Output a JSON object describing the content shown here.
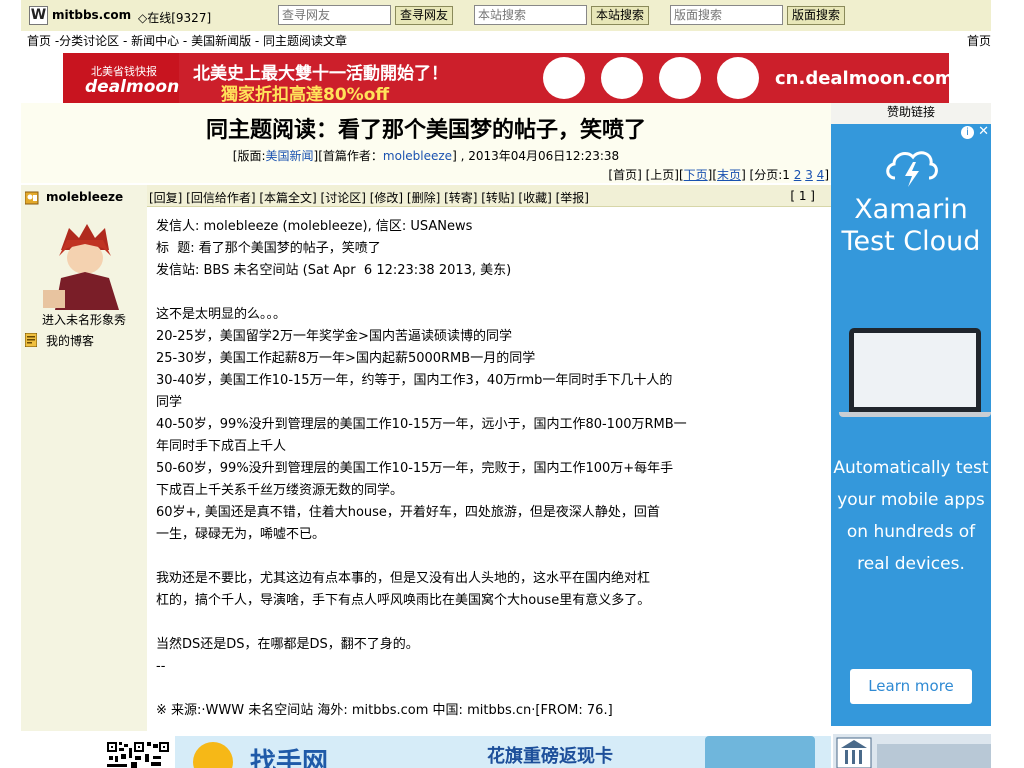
{
  "topbar": {
    "logo_letter": "W",
    "site_name": "mitbbs.com",
    "online_status": "◇在线[9327]",
    "search_friend_placeholder": "查寻网友",
    "search_friend_button": "查寻网友",
    "site_search_placeholder": "本站搜索",
    "site_search_button": "本站搜索",
    "board_search_placeholder": "版面搜索",
    "board_search_button": "版面搜索"
  },
  "breadcrumb": {
    "text": "首页 -分类讨论区 - 新闻中心 - 美国新闻版 - 同主题阅读文章",
    "home_right": "首页"
  },
  "dealmoon_banner": {
    "logo_small": "北美省钱快报",
    "logo_main": "dealmoon",
    "headline1": "北美史上最大雙十一活動開始了！",
    "headline2": "獨家折扣高達80%off",
    "url": "cn.dealmoon.com"
  },
  "thread": {
    "title": "同主题阅读：看了那个美国梦的帖子，笑喷了",
    "meta_prefix": "[版面:",
    "meta_board": "美国新闻",
    "meta_middle": "][首篇作者：",
    "meta_author": "molebleeze",
    "meta_suffix": "] , 2013年04月06日12:23:38",
    "pager_prefix": "[首页] [上页][",
    "pager_next": "下页",
    "pager_mid": "][",
    "pager_last": "末页",
    "pager_pages_label": "] [分页:1 ",
    "pager_page2": "2",
    "pager_page3": "3",
    "pager_page4": "4",
    "pager_close": "]"
  },
  "sponsor": {
    "label": "赞助链接",
    "info_icon": "i",
    "close_icon": "✕",
    "title_line1": "Xamarin",
    "title_line2": "Test Cloud",
    "body_line1": "Automatically test",
    "body_line2": "your mobile apps",
    "body_line3": "on hundreds of",
    "body_line4": "real devices.",
    "cta": "Learn more"
  },
  "author": {
    "name": "molebleeze",
    "avatar_caption": "进入未名形象秀",
    "blog_link": "我的博客"
  },
  "post": {
    "toolbar": "[回复] [回信给作者] [本篇全文] [讨论区] [修改] [删除] [转寄] [转贴] [收藏] [举报]",
    "floor": "[ 1 ]",
    "lines": [
      "发信人: molebleeze (molebleeze), 信区: USANews",
      "标  题: 看了那个美国梦的帖子，笑喷了",
      "发信站: BBS 未名空间站 (Sat Apr  6 12:23:38 2013, 美东)",
      "",
      "这不是太明显的么。。。",
      "20-25岁，美国留学2万一年奖学金>国内苦逼读硕读博的同学",
      "25-30岁，美国工作起薪8万一年>国内起薪5000RMB一月的同学",
      "30-40岁，美国工作10-15万一年，约等于，国内工作3，40万rmb一年同时手下几十人的",
      "同学",
      "40-50岁，99%没升到管理层的美国工作10-15万一年，远小于，国内工作80-100万RMB一",
      "年同时手下成百上千人",
      "50-60岁，99%没升到管理层的美国工作10-15万一年，完败于，国内工作100万+每年手",
      "下成百上千关系千丝万缕资源无数的同学。",
      "60岁+, 美国还是真不错，住着大house，开着好车，四处旅游，但是夜深人静处，回首",
      "一生，碌碌无为，唏嘘不已。",
      "",
      "我劝还是不要比，尤其这边有点本事的，但是又没有出人头地的，这水平在国内绝对杠",
      "杠的，搞个千人，导演啥，手下有点人呼风唤雨比在美国窝个大house里有意义多了。",
      "",
      "当然DS还是DS，在哪都是DS，翻不了身的。",
      "--",
      "",
      "※ 来源:·WWW 未名空间站 海外: mitbbs.com 中国: mitbbs.cn·[FROM: 76.]"
    ]
  },
  "bottom_ad": {
    "brand_text": "找手网",
    "promo_text": "花旗重磅返现卡"
  },
  "colors": {
    "topbar_bg": "#f0efce",
    "author_col_bg": "#f4f4e1",
    "link_blue": "#1a52b0",
    "dealmoon_red": "#cc1f2b",
    "xamarin_blue": "#3498db"
  }
}
